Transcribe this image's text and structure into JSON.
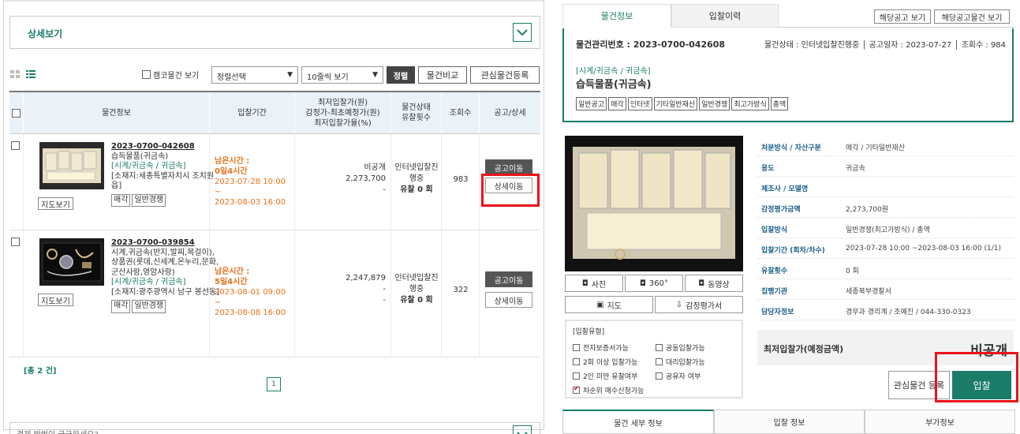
{
  "left": {
    "section_title": "상세보기",
    "toolbar": {
      "camco_label": "캠코물건 보기",
      "sort_select": "정렬선택",
      "page_size_select": "10줄씩 보기",
      "sort_button": "정렬",
      "compare_button": "물건비교",
      "favorite_register_button": "관심물건등록"
    },
    "table": {
      "headers": {
        "info": "물건정보",
        "period": "입찰기간",
        "price": "최저입찰가(원)\n감정가-최초예정가(원)\n최저입찰가율(%)",
        "status": "물건상태\n유찰횟수",
        "views": "조회수",
        "actions": "공고/상세"
      },
      "rows": [
        {
          "number": "2023-0700-042608",
          "name": "습득물품(귀금속)",
          "category": "[시계/귀금속 / 귀금속]",
          "location": "[소재지:세종특별자치시 조치원읍]",
          "tags": [
            "매각",
            "일반경쟁"
          ],
          "map_button": "지도보기",
          "remaining_label": "남은시간 :",
          "remaining": "0일4시간",
          "start": "2023-07-28 10:00 ~",
          "end": "2023-08-03 16:00",
          "price1": "비공개",
          "price2": "2,273,700",
          "price3": "-",
          "status": "인터넷입찰진행중",
          "fail_count": "유찰 0 회",
          "views": "983",
          "notice_button": "공고이동",
          "detail_button": "상세이동"
        },
        {
          "number": "2023-0700-039854",
          "name": "시계,귀금속(반지,발찌,목걸이),상품권(롯데,신세계,온누리,문화,군산사랑,영암사랑)",
          "category": "[시계/귀금속 / 귀금속]",
          "location": "[소재지:광주광역시 남구 봉선동]",
          "tags": [
            "매각",
            "일반경쟁"
          ],
          "map_button": "지도보기",
          "remaining_label": "남은시간 :",
          "remaining": "5일4시간",
          "start": "2023-08-01 09:00 ~",
          "end": "2023-08-08 16:00",
          "price1": "2,247,879",
          "price2": "-",
          "price3": "-",
          "status": "인터넷입찰진행중",
          "fail_count": "유찰 0 회",
          "views": "322",
          "notice_button": "공고이동",
          "detail_button": "상세이동"
        }
      ]
    },
    "total": "[총 2 건]",
    "page": "1",
    "bottom_text": "결제 방법이 궁금하세요?"
  },
  "right": {
    "tabs": [
      "물건정보",
      "입찰이력"
    ],
    "tab_buttons": [
      "해당공고 보기",
      "해당공고물건 보기"
    ],
    "mgmt_number": "물건관리번호 : 2023-0700-042608",
    "meta": "물건상태 : 인터넷입찰진행중 │ 공고일자 : 2023-07-27 │ 조회수 : 984",
    "category": "[시계/귀금속 / 귀금속]",
    "title": "습득물품(귀금속)",
    "tags": [
      "일반공고",
      "매각",
      "인터넷",
      "기타일반재산",
      "일반경쟁",
      "최고가방식",
      "총액"
    ],
    "media_buttons": [
      "사진",
      "360°",
      "동영상",
      "지도",
      "감정평가서"
    ],
    "bid_type": {
      "heading": "[입찰유형]",
      "items": [
        {
          "label": "전자보증서가능",
          "checked": false
        },
        {
          "label": "공동입찰가능",
          "checked": false
        },
        {
          "label": "2회 이상 입찰가능",
          "checked": false
        },
        {
          "label": "대리입찰가능",
          "checked": false
        },
        {
          "label": "2인 미만 유찰여부",
          "checked": false
        },
        {
          "label": "공유자 여부",
          "checked": false
        },
        {
          "label": "차순위 매수신청가능",
          "checked": true
        }
      ]
    },
    "props": [
      {
        "k": "처분방식 / 자산구분",
        "v": "매각 / 기타일반재산"
      },
      {
        "k": "용도",
        "v": "귀금속"
      },
      {
        "k": "제조사 / 모델명",
        "v": ""
      },
      {
        "k": "감정평가금액",
        "v": "2,273,700원"
      },
      {
        "k": "입찰방식",
        "v": "일반경쟁(최고가방식) / 총액"
      },
      {
        "k": "입찰기간 (회차/차수)",
        "v": "2023-07-28 10:00 ~2023-08-03 16:00 (1/1)"
      },
      {
        "k": "유찰횟수",
        "v": "0 회"
      },
      {
        "k": "집행기관",
        "v": "세종북부경찰서"
      },
      {
        "k": "담당자정보",
        "v": "경무과 경리계 / 조예진 / 044-330-0323"
      }
    ],
    "min_bid_label": "최저입찰가(예정금액)",
    "min_bid_value": "비공개",
    "favorite_button": "관심물건 등록",
    "bid_button": "입찰",
    "bottom_tabs": [
      "물건 세부 정보",
      "입찰 정보",
      "부가정보"
    ]
  },
  "colors": {
    "accent": "#1b7c6a",
    "highlight": "#e8141a",
    "orange": "#e8711b"
  }
}
